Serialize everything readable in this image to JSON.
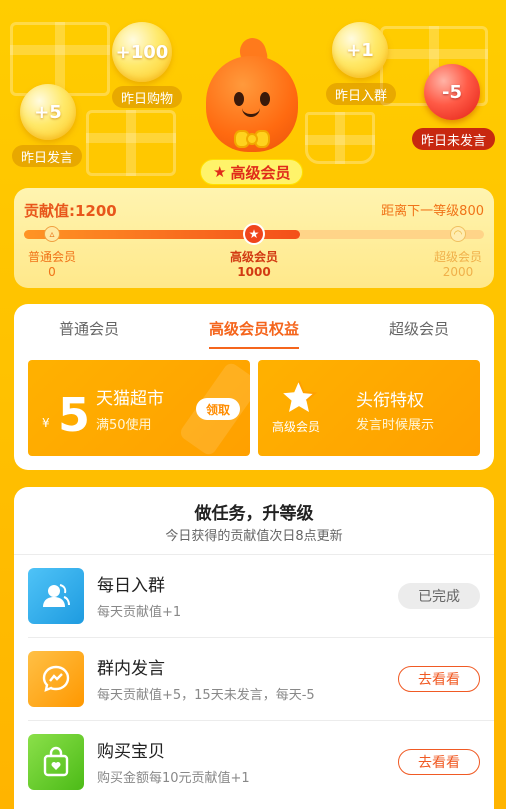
{
  "hero": {
    "bubbles": [
      {
        "value": "+100",
        "label": "昨日购物"
      },
      {
        "value": "+1",
        "label": "昨日入群"
      },
      {
        "value": "+5",
        "label": "昨日发言"
      },
      {
        "value": "-5",
        "label": "昨日未发言"
      }
    ],
    "level_tag": "高级会员",
    "level_star": "★"
  },
  "progress": {
    "contribution": "贡献值:1200",
    "next_level_distance": "距离下一等级800",
    "fill_fraction": 0.6,
    "levels": [
      {
        "name": "普通会员",
        "threshold": "0"
      },
      {
        "name": "高级会员",
        "threshold": "1000"
      },
      {
        "name": "超级会员",
        "threshold": "2000"
      }
    ]
  },
  "benefits": {
    "tabs": [
      "普通会员",
      "高级会员权益",
      "超级会员"
    ],
    "active_tab": 1,
    "coupon": {
      "currency": "¥",
      "amount": "5",
      "title": "天猫超市",
      "condition": "满50使用",
      "claim_label": "领取"
    },
    "headline": {
      "badge_label": "高级会员",
      "title": "头衔特权",
      "desc": "发言时候展示"
    }
  },
  "tasks": {
    "title": "做任务，升等级",
    "subtitle": "今日获得的贡献值次日8点更新",
    "items": [
      {
        "name": "每日入群",
        "desc": "每天贡献值+1",
        "button": "已完成",
        "icon": "user-group-icon",
        "color": "#29b6f6"
      },
      {
        "name": "群内发言",
        "desc": "每天贡献值+5，15天未发言，每天-5",
        "button": "去看看",
        "icon": "chat-bubble-icon",
        "color": "#ffa726"
      },
      {
        "name": "购买宝贝",
        "desc": "购买金额每10元贡献值+1",
        "button": "去看看",
        "icon": "shopping-bag-icon",
        "color": "#66cc33"
      }
    ]
  }
}
